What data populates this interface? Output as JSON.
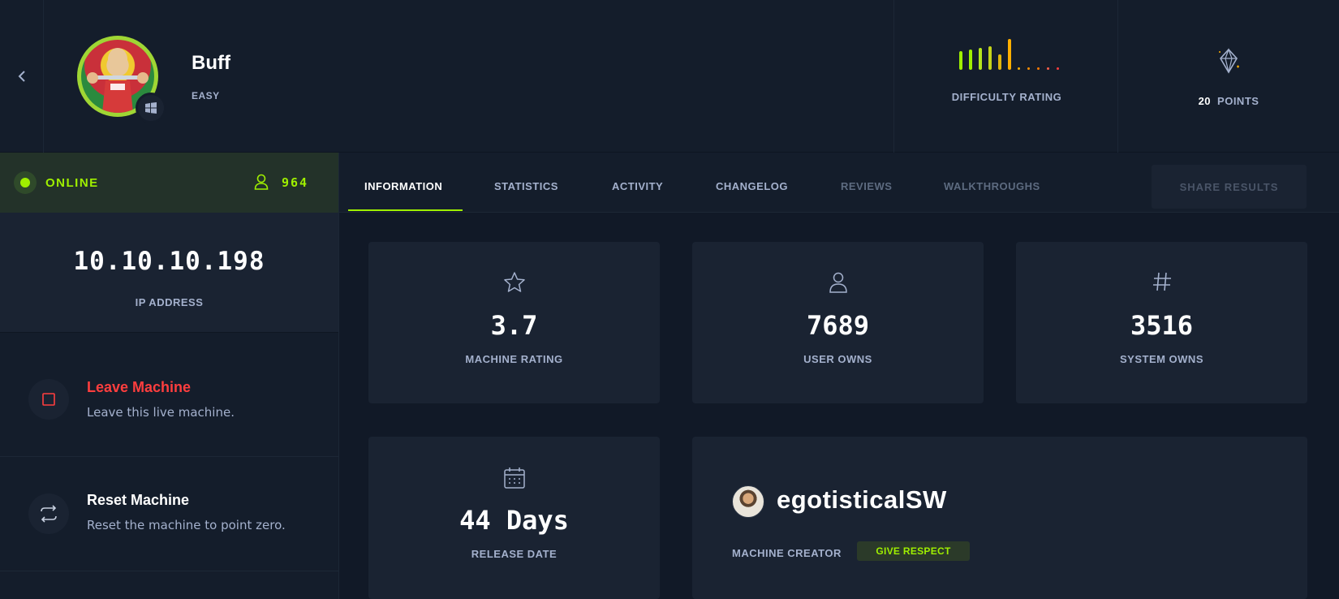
{
  "machine": {
    "name": "Buff",
    "difficulty": "EASY",
    "os_icon": "windows-icon"
  },
  "header": {
    "difficulty_rating_label": "DIFFICULTY RATING",
    "points_value": "20",
    "points_label": "POINTS",
    "difficulty_bars": [
      0.55,
      0.6,
      0.65,
      0.7,
      0.45,
      0.9,
      0.05,
      0.05,
      0.05,
      0.05,
      0.05
    ],
    "bar_colors": [
      "#9fef00",
      "#9fef00",
      "#b5e61d",
      "#c5d41a",
      "#e0b60d",
      "#ffaf00",
      "#ffaf00",
      "#ff8f00",
      "#ff7a00",
      "#ff5f4a",
      "#ff3e3e"
    ]
  },
  "status": {
    "text": "ONLINE",
    "players": "964",
    "color": "#9fef00"
  },
  "ip": {
    "value": "10.10.10.198",
    "label": "IP ADDRESS"
  },
  "actions": {
    "leave": {
      "title": "Leave Machine",
      "desc": "Leave this live machine.",
      "color": "#ff3e3e"
    },
    "reset": {
      "title": "Reset Machine",
      "desc": "Reset the machine to point zero."
    }
  },
  "tabs": [
    {
      "label": "INFORMATION"
    },
    {
      "label": "STATISTICS"
    },
    {
      "label": "ACTIVITY"
    },
    {
      "label": "CHANGELOG"
    },
    {
      "label": "REVIEWS"
    },
    {
      "label": "WALKTHROUGHS"
    }
  ],
  "share_label": "SHARE RESULTS",
  "cards": {
    "rating": {
      "value": "3.7",
      "label": "MACHINE RATING",
      "icon": "star-icon"
    },
    "user_owns": {
      "value": "7689",
      "label": "USER OWNS",
      "icon": "user-icon"
    },
    "system_owns": {
      "value": "3516",
      "label": "SYSTEM OWNS",
      "icon": "hash-icon"
    },
    "release": {
      "value": "44 Days",
      "label": "RELEASE DATE",
      "icon": "calendar-icon"
    }
  },
  "creator": {
    "name": "egotisticalSW",
    "label": "MACHINE CREATOR",
    "respect_label": "GIVE RESPECT"
  },
  "colors": {
    "accent": "#9fef00",
    "background": "#111927",
    "panel": "#1a2332",
    "muted": "#a4b1cd"
  }
}
